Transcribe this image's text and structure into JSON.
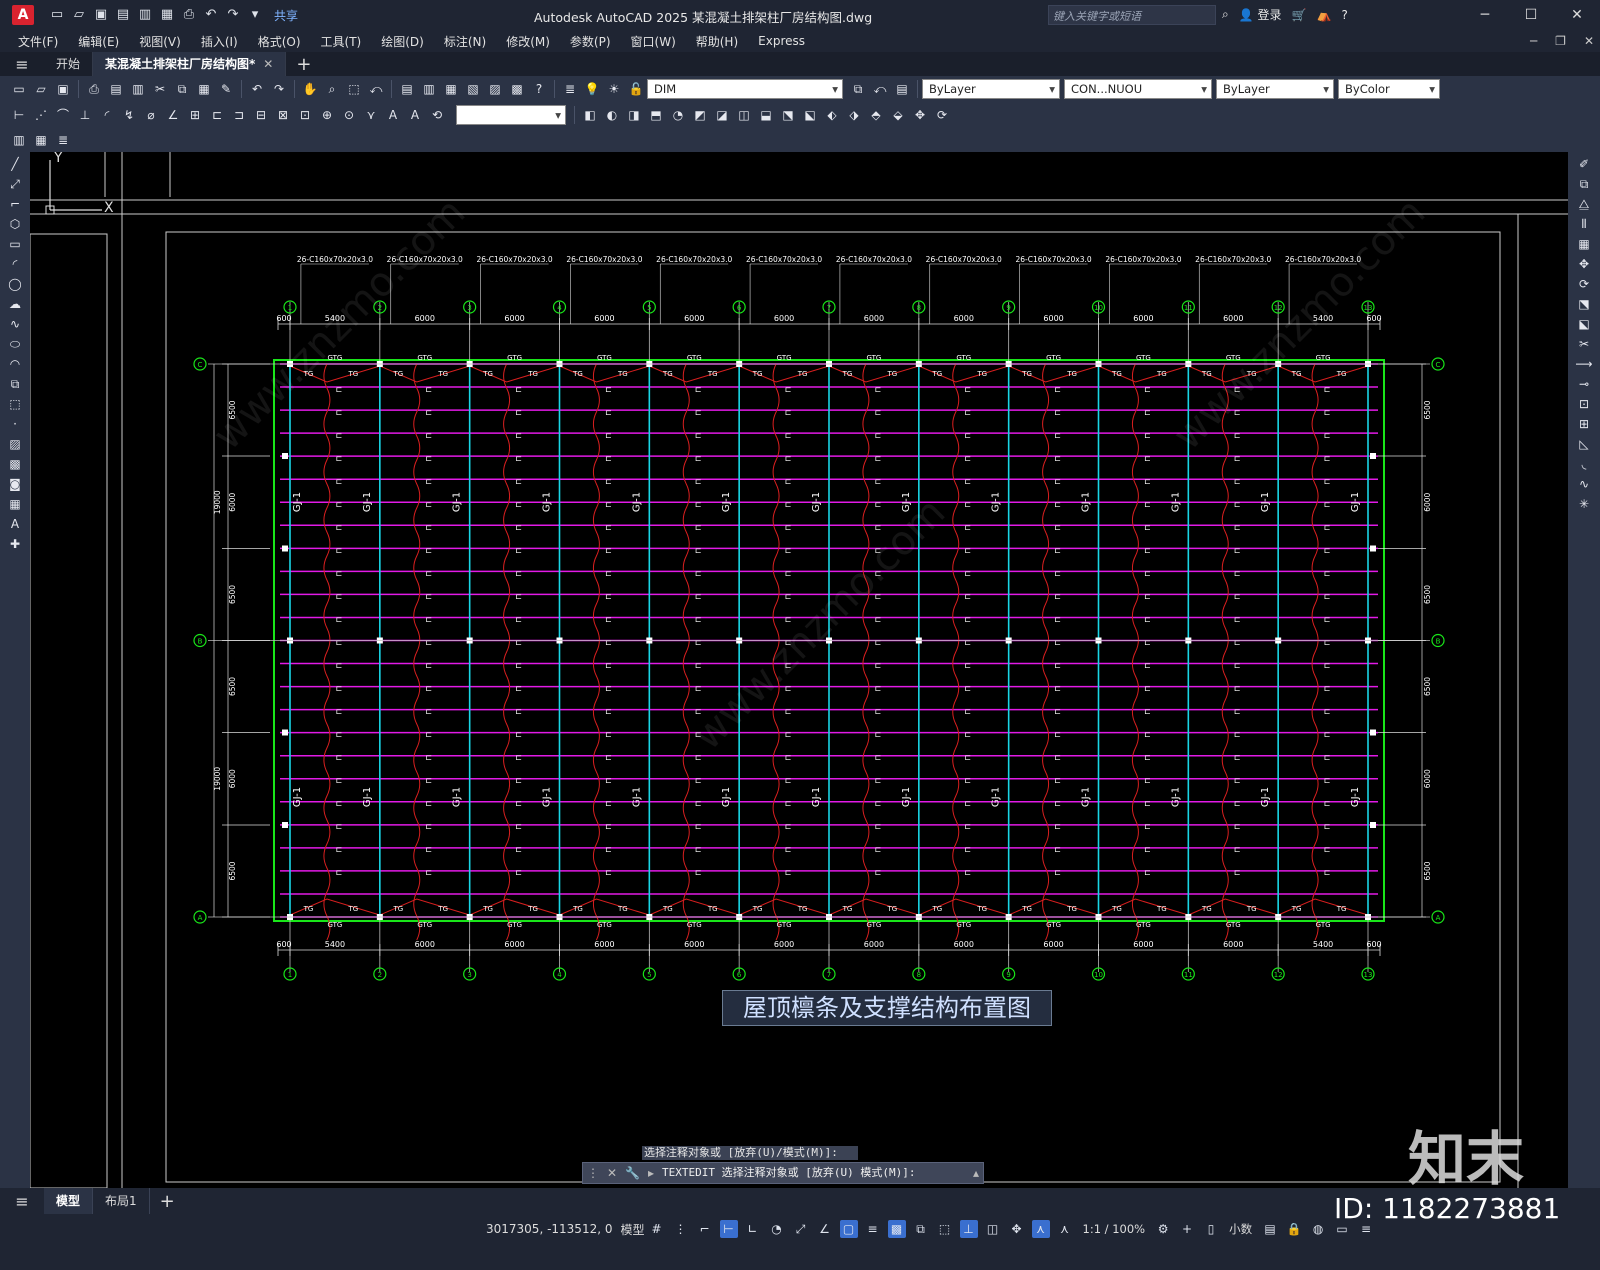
{
  "app": {
    "title": "Autodesk AutoCAD 2025    某混凝土排架柱厂房结构图.dwg",
    "search_placeholder": "键入关键字或短语",
    "login": "登录",
    "share": "共享"
  },
  "menu": [
    "文件(F)",
    "编辑(E)",
    "视图(V)",
    "插入(I)",
    "格式(O)",
    "工具(T)",
    "绘图(D)",
    "标注(N)",
    "修改(M)",
    "参数(P)",
    "窗口(W)",
    "帮助(H)",
    "Express"
  ],
  "doc_tabs": {
    "start": "开始",
    "active": "某混凝土排架柱厂房结构图*"
  },
  "layer_bar": {
    "layer": "DIM",
    "color": "ByLayer",
    "linetype": "CON...NUOU",
    "lineweight": "ByLayer",
    "plotstyle": "ByColor"
  },
  "drawing": {
    "title": "屋顶檩条及支撑结构布置图",
    "column_labels": [
      "1",
      "2",
      "3",
      "4",
      "5",
      "6",
      "7",
      "8",
      "9",
      "10",
      "11",
      "12",
      "13"
    ],
    "row_labels": [
      "C",
      "B",
      "A"
    ],
    "bay_spacings": [
      "600",
      "5400",
      "6000",
      "6000",
      "6000",
      "6000",
      "6000",
      "6000",
      "6000",
      "6000",
      "6000",
      "6000",
      "5400",
      "600"
    ],
    "purlin_callout": "26-C160x70x20x3.0",
    "truss_label": "GJ-1",
    "brace_label": "TG",
    "tie_label": "GTG",
    "left_dims": [
      "6500",
      "6000",
      "6500",
      "6500",
      "6000",
      "6500"
    ],
    "span_dim": "19000",
    "right_dims": [
      "6500",
      "6000",
      "6500",
      "6500",
      "6000",
      "6500"
    ]
  },
  "command": {
    "history": "选择注释对象或 [放弃(U)/模式(M)]:",
    "current": "TEXTEDIT 选择注释对象或 [放弃(U) 模式(M)]:"
  },
  "layout_tabs": [
    "模型",
    "布局1"
  ],
  "status": {
    "coords": "3017305, -113512, 0",
    "space": "模型",
    "scale": "1:1 / 100%",
    "units": "小数"
  },
  "watermark": {
    "logo": "知末",
    "id": "ID: 1182273881"
  },
  "colors": {
    "purlin": "#e21ae6",
    "truss": "#19d5e6",
    "brace": "#d81f1f",
    "frame": "#19e619",
    "axis": "#19e619",
    "white": "#ffffff"
  }
}
